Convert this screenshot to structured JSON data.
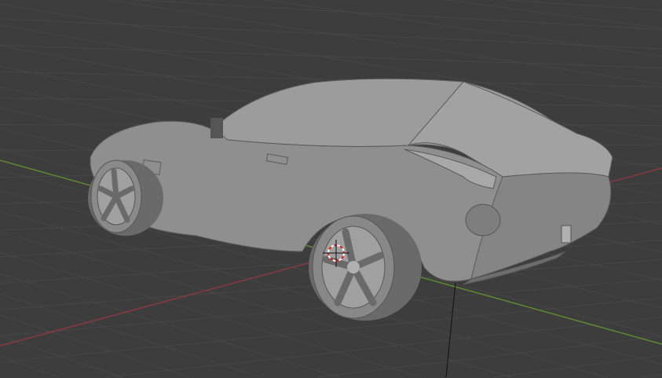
{
  "viewport": {
    "background": "#3d3d3d",
    "grid_color": "#4a4a4a",
    "x_axis_color": "#8a3a3f",
    "y_axis_color": "#5f8a2e",
    "model_color": "#9a9a9a"
  },
  "icons": {
    "cursor": "3d-cursor-icon"
  }
}
